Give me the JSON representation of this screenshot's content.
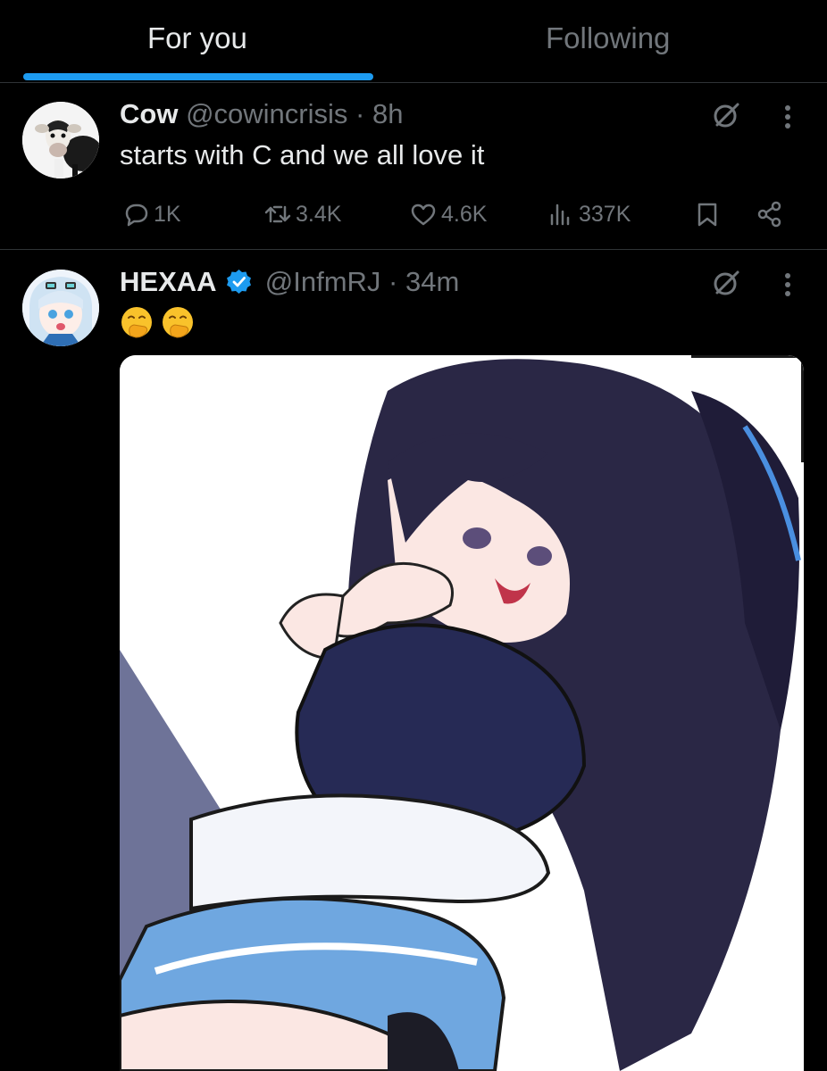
{
  "tabs": {
    "for_you": "For you",
    "following": "Following"
  },
  "posts": [
    {
      "display_name": "Cow",
      "handle": "@cowincrisis",
      "separator": "·",
      "time": "8h",
      "text": "starts with C and we all love it",
      "actions": {
        "replies": "1K",
        "reposts": "3.4K",
        "likes": "4.6K",
        "views": "337K"
      }
    },
    {
      "display_name": "HEXAA",
      "verified": true,
      "handle": "@InfmRJ",
      "separator": "·",
      "time": "34m",
      "emoji": [
        "face-with-hand-over-mouth",
        "face-with-hand-over-mouth"
      ]
    }
  ],
  "colors": {
    "background": "#000000",
    "primary_text": "#e7e9ea",
    "secondary_text": "#71767b",
    "accent": "#1d9bf0",
    "divider": "#2f3336"
  },
  "icons": [
    "reply-icon",
    "repost-icon",
    "like-icon",
    "views-icon",
    "bookmark-icon",
    "share-icon",
    "grok-icon",
    "more-icon",
    "verified-badge-icon"
  ]
}
